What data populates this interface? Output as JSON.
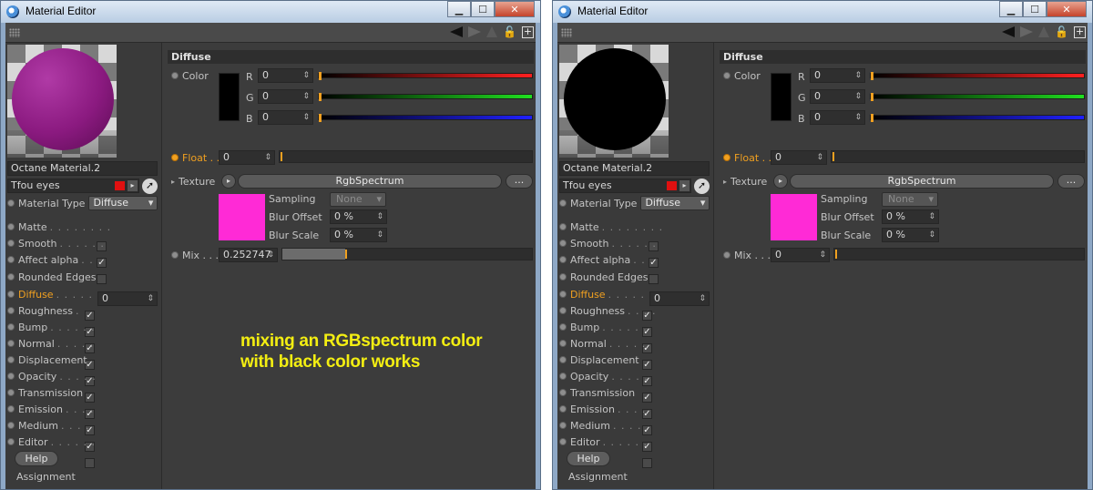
{
  "windows": [
    {
      "title": "Material Editor",
      "material_name": "Octane Material.2",
      "texture_name": "Tfou eyes",
      "material_type_label": "Material Type",
      "material_type_value": "Diffuse",
      "preview_color": "#8b1a80",
      "checkboxes": [
        {
          "label": "Matte",
          "dots": ". . . . . . . .",
          "checked": false
        },
        {
          "label": "Smooth",
          "dots": ". . . . . .",
          "checked": true
        },
        {
          "label": "Affect alpha",
          "dots": ". .",
          "checked": false
        }
      ],
      "rounded_edges_label": "Rounded Edges",
      "rounded_edges_value": "0",
      "channels": [
        {
          "label": "Diffuse",
          "dots": ". . . . .",
          "active": true
        },
        {
          "label": "Roughness",
          "dots": ".",
          "active": false
        },
        {
          "label": "Bump",
          "dots": ". . . . . .",
          "active": false
        },
        {
          "label": "Normal",
          "dots": ". . . . .",
          "active": false
        },
        {
          "label": "Displacement",
          "dots": "",
          "active": false
        },
        {
          "label": "Opacity",
          "dots": ". . . . .",
          "active": false
        },
        {
          "label": "Transmission",
          "dots": "",
          "active": false
        },
        {
          "label": "Emission",
          "dots": ". . . .",
          "active": false
        },
        {
          "label": "Medium",
          "dots": ". . . .",
          "active": false
        },
        {
          "label": "Editor",
          "dots": ". . . . . .",
          "active": false
        }
      ],
      "help_label": "Help",
      "assignment_label": "Assignment",
      "section_title": "Diffuse",
      "color_label": "Color",
      "rgb": [
        {
          "ch": "R",
          "value": "0"
        },
        {
          "ch": "G",
          "value": "0"
        },
        {
          "ch": "B",
          "value": "0"
        }
      ],
      "float_label": "Float . .",
      "float_value": "0",
      "texture_label": "Texture",
      "texture_button": "RgbSpectrum",
      "ellipsis": "...",
      "swatch_color": "#ff2ad6",
      "sampling_label": "Sampling",
      "sampling_value": "None",
      "blur_offset_label": "Blur Offset",
      "blur_offset_value": "0 %",
      "blur_scale_label": "Blur Scale",
      "blur_scale_value": "0 %",
      "mix_label": "Mix . . .",
      "mix_value": "0.252747",
      "mix_fraction": 0.252747,
      "note_line1": "mixing an RGBspectrum color",
      "note_line2": "with black color works"
    },
    {
      "title": "Material Editor",
      "material_name": "Octane Material.2",
      "texture_name": "Tfou eyes",
      "material_type_label": "Material Type",
      "material_type_value": "Diffuse",
      "preview_color": "#000000",
      "checkboxes": [
        {
          "label": "Matte",
          "dots": ". . . . . . . .",
          "checked": false
        },
        {
          "label": "Smooth",
          "dots": ". . . . . .",
          "checked": true
        },
        {
          "label": "Affect alpha",
          "dots": ". .",
          "checked": false
        }
      ],
      "rounded_edges_label": "Rounded Edges",
      "rounded_edges_value": "0",
      "channels": [
        {
          "label": "Diffuse",
          "dots": ". . . . .",
          "active": true
        },
        {
          "label": "Roughness",
          "dots": ". . . .",
          "active": false
        },
        {
          "label": "Bump",
          "dots": ". . . . . .",
          "active": false
        },
        {
          "label": "Normal",
          "dots": ". . . . .",
          "active": false
        },
        {
          "label": "Displacement",
          "dots": "",
          "active": false
        },
        {
          "label": "Opacity",
          "dots": ". . . . .",
          "active": false
        },
        {
          "label": "Transmission",
          "dots": "",
          "active": false
        },
        {
          "label": "Emission",
          "dots": ". . . .",
          "active": false
        },
        {
          "label": "Medium",
          "dots": ". . . .",
          "active": false
        },
        {
          "label": "Editor",
          "dots": ". . . . . .",
          "active": false
        }
      ],
      "help_label": "Help",
      "assignment_label": "Assignment",
      "section_title": "Diffuse",
      "color_label": "Color",
      "rgb": [
        {
          "ch": "R",
          "value": "0"
        },
        {
          "ch": "G",
          "value": "0"
        },
        {
          "ch": "B",
          "value": "0"
        }
      ],
      "float_label": "Float . .",
      "float_value": "0",
      "texture_label": "Texture",
      "texture_button": "RgbSpectrum",
      "ellipsis": "...",
      "swatch_color": "#ff2ad6",
      "sampling_label": "Sampling",
      "sampling_value": "None",
      "blur_offset_label": "Blur Offset",
      "blur_offset_value": "0 %",
      "blur_scale_label": "Blur Scale",
      "blur_scale_value": "0 %",
      "mix_label": "Mix . . .",
      "mix_value": "0",
      "mix_fraction": 0,
      "note_line1": "",
      "note_line2": ""
    }
  ],
  "window_buttons": {
    "minimize": "▁",
    "maximize": "☐",
    "close": "✕"
  },
  "toolbar": {
    "lock": "🔓",
    "new": "+"
  }
}
